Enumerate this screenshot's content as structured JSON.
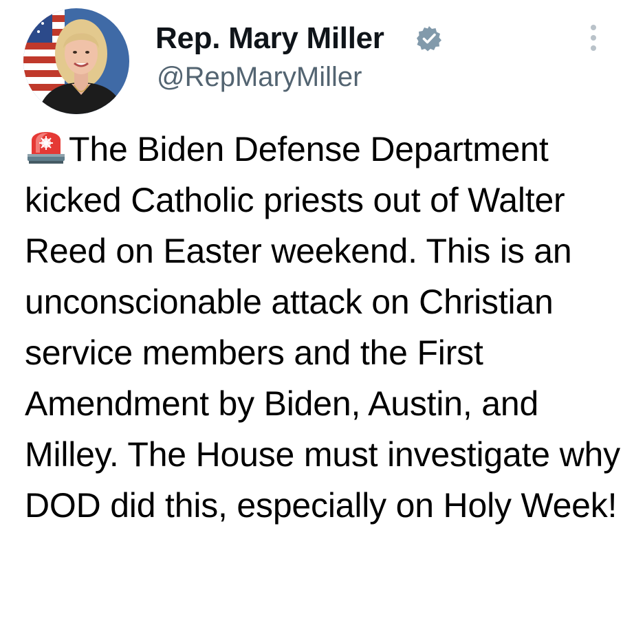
{
  "author": {
    "display_name": "Rep. Mary Miller",
    "handle": "@RepMaryMiller",
    "verified": true,
    "verified_color": "#829aab",
    "avatar_icon": "profile-photo-avatar"
  },
  "menu": {
    "icon": "more-options-icon"
  },
  "post": {
    "lead_icon": "police-siren-emoji",
    "text": "The Biden Defense Department kicked Catholic priests out of Walter Reed on Easter weekend. This is an unconscionable attack on Christian service members and the First Amendment by Biden, Austin, and Milley. The House must investigate why DOD did this, especially on Holy Week!"
  }
}
